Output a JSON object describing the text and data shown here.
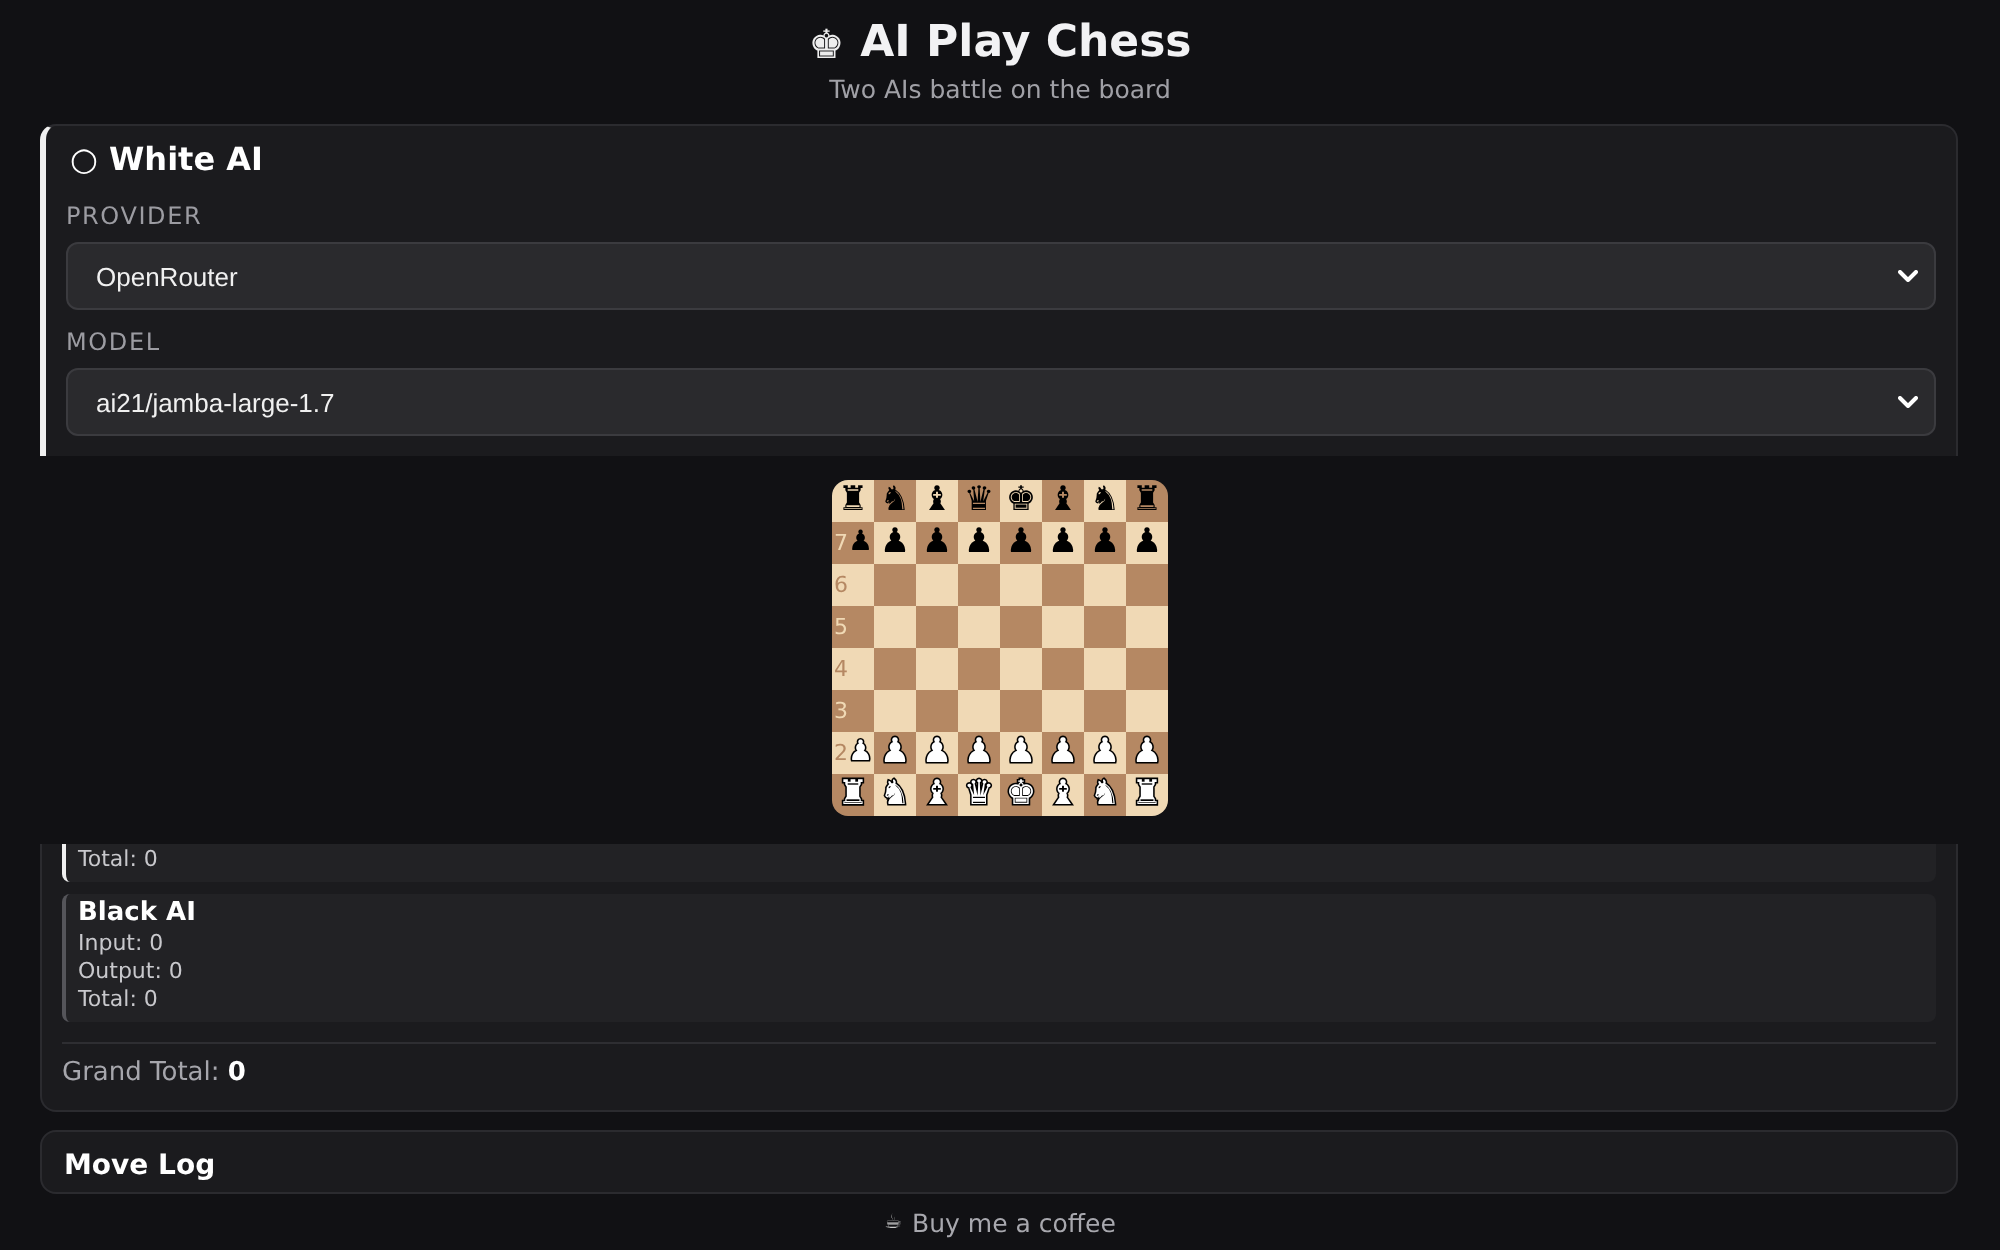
{
  "header": {
    "logo": "♚",
    "title": "AI Play Chess",
    "subtitle": "Two AIs battle on the board"
  },
  "white_ai_panel": {
    "title": "○ White AI",
    "fields": [
      {
        "label": "PROVIDER",
        "value": "OpenRouter"
      },
      {
        "label": "MODEL",
        "value": "ai21/jamba-large-1.7"
      }
    ]
  },
  "board": {
    "ranks": [
      {
        "pieces": [
          {
            "glyph": "♜",
            "kind": "black"
          },
          {
            "glyph": "♞",
            "kind": "black"
          },
          {
            "glyph": "♝",
            "kind": "black"
          },
          {
            "glyph": "♛",
            "kind": "black"
          },
          {
            "glyph": "♚",
            "kind": "black"
          },
          {
            "glyph": "♝",
            "kind": "black"
          },
          {
            "glyph": "♞",
            "kind": "black"
          },
          {
            "glyph": "♜",
            "kind": "black"
          }
        ]
      },
      {
        "label": "7",
        "pieces": [
          {
            "glyph": "♟",
            "kind": "black"
          },
          {
            "glyph": "♟",
            "kind": "black"
          },
          {
            "glyph": "♟",
            "kind": "black"
          },
          {
            "glyph": "♟",
            "kind": "black"
          },
          {
            "glyph": "♟",
            "kind": "black"
          },
          {
            "glyph": "♟",
            "kind": "black"
          },
          {
            "glyph": "♟",
            "kind": "black"
          },
          {
            "glyph": "♟",
            "kind": "black"
          }
        ]
      },
      {
        "label": "6"
      },
      {
        "label": "5"
      },
      {
        "label": "4"
      },
      {
        "label": "3"
      },
      {
        "label": "2",
        "pieces": [
          {
            "glyph": "♟",
            "kind": "white"
          },
          {
            "glyph": "♟",
            "kind": "white"
          },
          {
            "glyph": "♟",
            "kind": "white"
          },
          {
            "glyph": "♟",
            "kind": "white"
          },
          {
            "glyph": "♟",
            "kind": "white"
          },
          {
            "glyph": "♟",
            "kind": "white"
          },
          {
            "glyph": "♟",
            "kind": "white"
          },
          {
            "glyph": "♟",
            "kind": "white"
          }
        ]
      },
      {
        "pieces": [
          {
            "glyph": "♜",
            "kind": "white"
          },
          {
            "glyph": "♞",
            "kind": "white"
          },
          {
            "glyph": "♝",
            "kind": "white"
          },
          {
            "glyph": "♛",
            "kind": "white"
          },
          {
            "glyph": "♚",
            "kind": "white"
          },
          {
            "glyph": "♝",
            "kind": "white"
          },
          {
            "glyph": "♞",
            "kind": "white"
          },
          {
            "glyph": "♜",
            "kind": "white"
          }
        ]
      }
    ]
  },
  "token_usage": {
    "players": [
      {
        "kind": "white",
        "lines": [
          "Total: 0"
        ]
      },
      {
        "kind": "black",
        "title": "Black AI",
        "lines": [
          "Input: 0",
          "Output: 0",
          "Total: 0"
        ]
      }
    ],
    "grand_total": "Grand Total: **0**"
  },
  "move_log": {
    "title": "Move Log"
  },
  "footer": {
    "icon": "☕",
    "link": "Buy me a coffee"
  }
}
